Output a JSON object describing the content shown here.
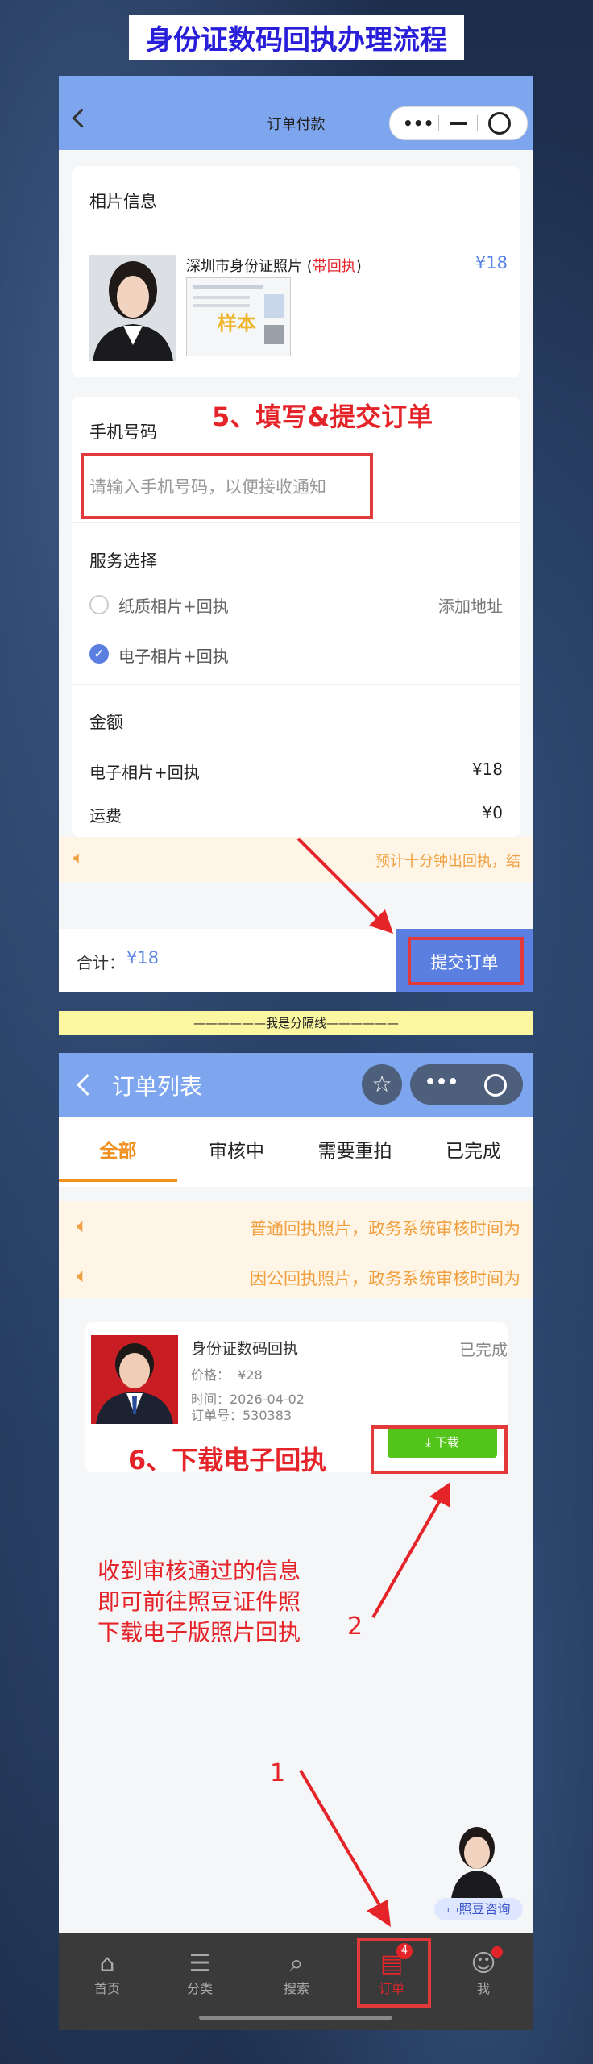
{
  "banner_title": "身份证数码回执办理流程",
  "page1": {
    "header_title": "订单付款",
    "photo_section_title": "相片信息",
    "product_name_prefix": "深圳市身份证照片 (",
    "product_name_highlight": "带回执",
    "product_name_suffix": ")",
    "product_price": "¥18",
    "sample_stamp": "样本",
    "step_label": "5、填写&提交订单",
    "phone_label": "手机号码",
    "phone_placeholder": "请输入手机号码，以便接收通知",
    "service_label": "服务选择",
    "option_paper": "纸质相片+回执",
    "add_address": "添加地址",
    "option_digital": "电子相片+回执",
    "amount_label": "金额",
    "line_item_label": "电子相片+回执",
    "line_item_price": "¥18",
    "shipping_label": "运费",
    "shipping_price": "¥0",
    "notice": "预计十分钟出回执，结",
    "total_label": "合计：",
    "total_value": "¥18",
    "submit_button": "提交订单"
  },
  "divider_text": "——————我是分隔线——————",
  "page2": {
    "header_title": "订单列表",
    "tabs": [
      "全部",
      "审核中",
      "需要重拍",
      "已完成"
    ],
    "active_tab_index": 0,
    "notice_1": "普通回执照片，政务系统审核时间为",
    "notice_2": "因公回执照片，政务系统审核时间为",
    "order": {
      "title": "身份证数码回执",
      "status": "已完成",
      "price": "价格：  ¥28",
      "time": "时间：2026-04-02",
      "order_no": "订单号：530383",
      "download_button": "下载"
    },
    "step_label": "6、下载电子回执",
    "instruction_lines": [
      "收到审核通过的信息",
      "即可前往照豆证件照",
      "下载电子版照片回执"
    ],
    "arrow_label_2": "2",
    "arrow_label_1": "1",
    "consult_label": "照豆咨询",
    "nav": [
      {
        "label": "首页",
        "icon": "home-icon"
      },
      {
        "label": "分类",
        "icon": "category-icon"
      },
      {
        "label": "搜索",
        "icon": "search-icon"
      },
      {
        "label": "订单",
        "icon": "order-icon",
        "badge": "4"
      },
      {
        "label": "我",
        "icon": "profile-icon"
      }
    ]
  },
  "colors": {
    "accent_blue": "#7ea6ee",
    "tab_orange": "#f0901e",
    "annotation_red": "#e5242a",
    "download_green": "#52c41a"
  }
}
